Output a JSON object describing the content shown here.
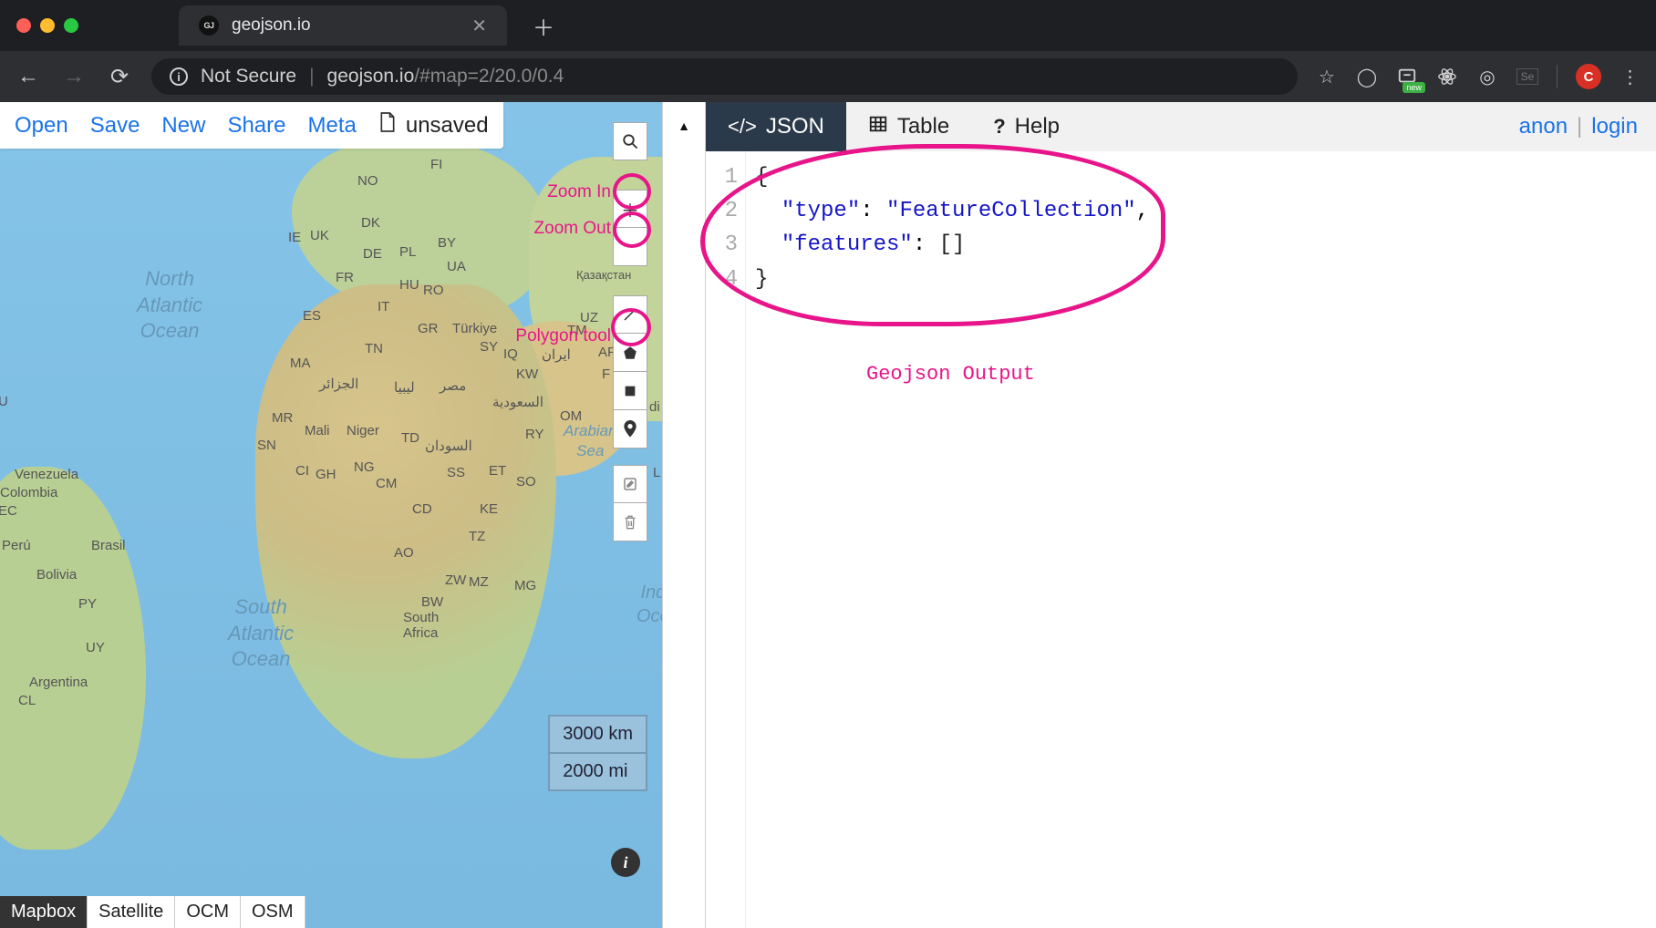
{
  "browser": {
    "tab_title": "geojson.io",
    "favicon_text": "GJ",
    "not_secure": "Not Secure",
    "url_host": "geojson.io",
    "url_path": "/#map=2/20.0/0.4",
    "new_badge": "new",
    "avatar_letter": "C"
  },
  "toolbar": {
    "open": "Open",
    "save": "Save",
    "new": "New",
    "share": "Share",
    "meta": "Meta",
    "unsaved": "unsaved"
  },
  "annotations": {
    "zoom_in": "Zoom In",
    "zoom_out": "Zoom Out",
    "polygon_tool": "Polygon tool",
    "output": "Geojson Output"
  },
  "scale": {
    "km": "3000 km",
    "mi": "2000 mi"
  },
  "basemaps": {
    "mapbox": "Mapbox",
    "satellite": "Satellite",
    "ocm": "OCM",
    "osm": "OSM"
  },
  "tabs": {
    "json": "JSON",
    "table": "Table",
    "help": "Help"
  },
  "user": {
    "anon": "anon",
    "login": "login"
  },
  "editor": {
    "line_numbers": [
      "1",
      "2",
      "3",
      "4"
    ],
    "l1": "{",
    "l2_key": "\"type\"",
    "l2_val": "\"FeatureCollection\"",
    "l3_key": "\"features\"",
    "l3_val": "[]",
    "l4": "}"
  },
  "map_labels": {
    "north_atlantic": "North\nAtlantic\nOcean",
    "south_atlantic": "South\nAtlantic\nOcean",
    "arabian_sea": "Arabian\nSea",
    "ind": "Ind\nOce",
    "venezuela": "Venezuela",
    "colombia": "Colombia",
    "ec": "EC",
    "peru": "Perú",
    "brasil": "Brasil",
    "bolivia": "Bolivia",
    "py": "PY",
    "uy": "UY",
    "argentina": "Argentina",
    "cl": "CL",
    "u": "U",
    "ie": "IE",
    "uk": "UK",
    "no": "NO",
    "fi": "FI",
    "dk": "DK",
    "de": "DE",
    "pl": "PL",
    "by": "BY",
    "ua": "UA",
    "fr": "FR",
    "es": "ES",
    "it": "IT",
    "hu": "HU",
    "ro": "RO",
    "gr": "GR",
    "turkiye": "Türkiye",
    "sy": "SY",
    "iq": "IQ",
    "iran": "ایران",
    "af": "AF",
    "uz": "UZ",
    "tm": "TM",
    "kazakhstan": "Қазақстан",
    "f": "F",
    "di": "di",
    "l": "L",
    "kw": "KW",
    "om": "OM",
    "ma": "MA",
    "algeria": "الجزائر",
    "libya": "ليبيا",
    "egypt": "مصر",
    "saudi": "السعودية",
    "tn": "TN",
    "mr": "MR",
    "mali": "Mali",
    "niger": "Niger",
    "td": "TD",
    "sudan": "السودان",
    "sn": "SN",
    "ng": "NG",
    "ci": "CI",
    "gh": "GH",
    "cm": "CM",
    "cd": "CD",
    "ss": "SS",
    "et": "ET",
    "so": "SO",
    "ke": "KE",
    "tz": "TZ",
    "ao": "AO",
    "zw": "ZW",
    "mz": "MZ",
    "bw": "BW",
    "south_africa": "South\nAfrica",
    "mg": "MG",
    "ry": "RY"
  }
}
